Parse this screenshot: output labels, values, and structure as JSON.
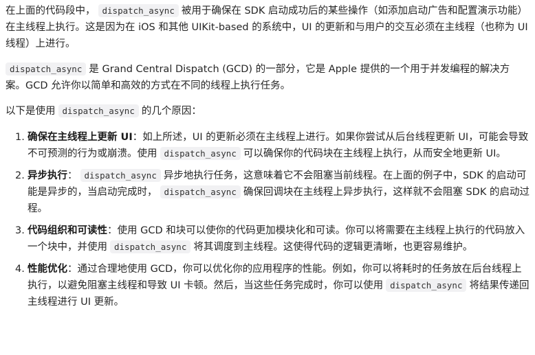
{
  "p1": {
    "pre": "在上面的代码段中，",
    "code": "dispatch_async",
    "post": "被用于确保在 SDK 启动成功后的某些操作（如添加启动广告和配置演示功能）在主线程上执行。这是因为在 iOS 和其他 UIKit-based 的系统中，UI 的更新和与用户的交互必须在主线程（也称为 UI 线程）上进行。"
  },
  "p2": {
    "code": "dispatch_async",
    "post": "是 Grand Central Dispatch (GCD) 的一部分，它是 Apple 提供的一个用于并发编程的解决方案。GCD 允许你以简单和高效的方式在不同的线程上执行任务。"
  },
  "p3": {
    "pre": "以下是使用",
    "code": "dispatch_async",
    "post": "的几个原因："
  },
  "items": [
    {
      "num": "1.",
      "title": "确保在主线程上更新 UI",
      "t1": "：如上所述，UI 的更新必须在主线程上进行。如果你尝试从后台线程更新 UI，可能会导致不可预测的行为或崩溃。使用",
      "code": "dispatch_async",
      "t2": "可以确保你的代码块在主线程上执行，从而安全地更新 UI。"
    },
    {
      "num": "2.",
      "title": "异步执行",
      "t1": "：",
      "code": "dispatch_async",
      "t2": "异步地执行任务，这意味着它不会阻塞当前线程。在上面的例子中，SDK 的启动可能是异步的，当启动完成时，",
      "code2": "dispatch_async",
      "t3": "确保回调块在主线程上异步执行，这样就不会阻塞 SDK 的启动过程。"
    },
    {
      "num": "3.",
      "title": "代码组织和可读性",
      "t1": "：使用 GCD 和块可以使你的代码更加模块化和可读。你可以将需要在主线程上执行的代码放入一个块中，并使用",
      "code": "dispatch_async",
      "t2": "将其调度到主线程。这使得代码的逻辑更清晰，也更容易维护。"
    },
    {
      "num": "4.",
      "title": "性能优化",
      "t1": "：通过合理地使用 GCD，你可以优化你的应用程序的性能。例如，你可以将耗时的任务放在后台线程上执行，以避免阻塞主线程和导致 UI 卡顿。然后，当这些任务完成时，你可以使用",
      "code": "dispatch_async",
      "t2": "将结果传递回主线程进行 UI 更新。"
    }
  ]
}
